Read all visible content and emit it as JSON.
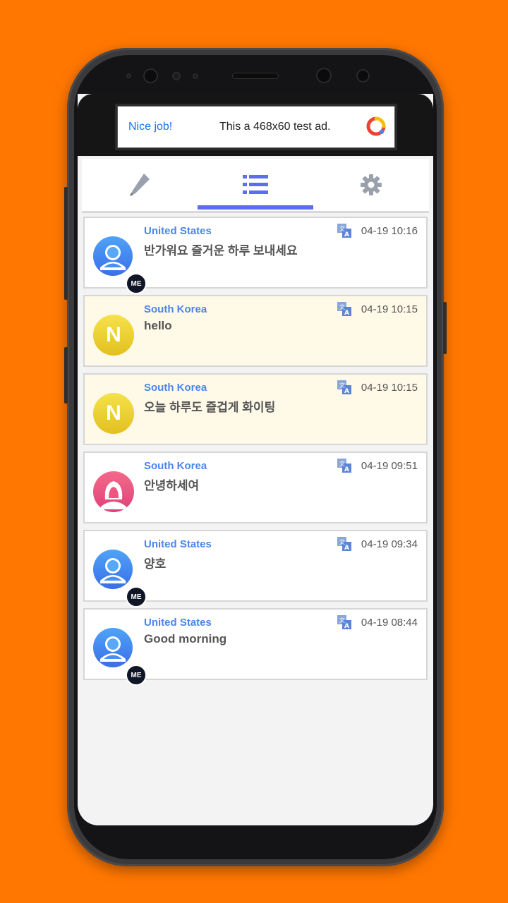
{
  "ad": {
    "left_text": "Nice job!",
    "center_text": "This a 468x60 test ad."
  },
  "tabs": [
    {
      "icon": "pencil-icon"
    },
    {
      "icon": "list-icon"
    },
    {
      "icon": "gear-icon"
    }
  ],
  "active_tab": "list",
  "colors": {
    "background": "#ff7700",
    "accent": "#5b6ef0",
    "country_text": "#4a86e8",
    "partner_card": "#fff9e8"
  },
  "messages": [
    {
      "country": "United States",
      "text": "반가워요 즐거운 하루 보내세요",
      "time": "04-19 10:16",
      "sender": "me",
      "badge": "ME"
    },
    {
      "country": "South Korea",
      "text": "hello",
      "time": "04-19 10:15",
      "sender": "partner-n",
      "initial": "N"
    },
    {
      "country": "South Korea",
      "text": "오늘 하루도 즐겁게 화이팅",
      "time": "04-19 10:15",
      "sender": "partner-n",
      "initial": "N"
    },
    {
      "country": "South Korea",
      "text": "안녕하세여",
      "time": "04-19 09:51",
      "sender": "partner-female"
    },
    {
      "country": "United States",
      "text": "양호",
      "time": "04-19 09:34",
      "sender": "me",
      "badge": "ME"
    },
    {
      "country": "United States",
      "text": "Good morning",
      "time": "04-19 08:44",
      "sender": "me",
      "badge": "ME"
    }
  ]
}
